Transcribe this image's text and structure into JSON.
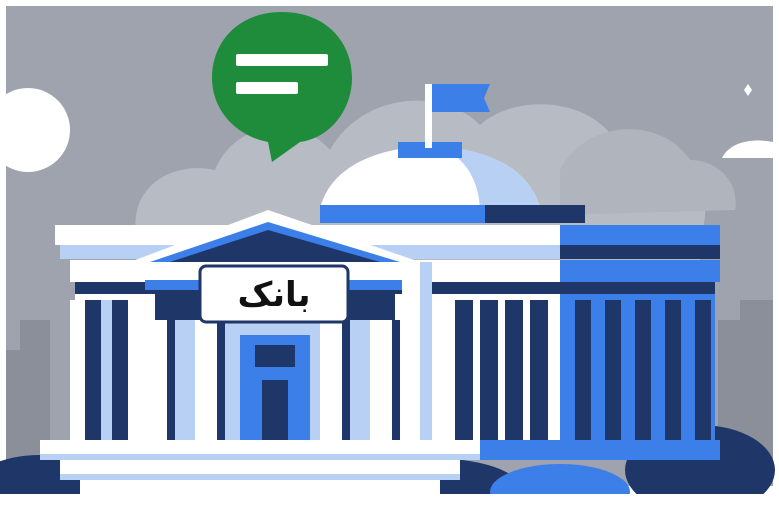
{
  "illustration": {
    "sign_text": "بانک",
    "subject": "bank-building",
    "icons": [
      "chat-bubble-icon",
      "flag-icon",
      "sun-icon",
      "sparkle-icon"
    ]
  },
  "colors": {
    "background": "#9ea3ad",
    "cloud": "#c6c9d0",
    "skyline": "#8a8f99",
    "navy": "#1e3668",
    "blue": "#3d7fe8",
    "light_blue": "#b9d0f5",
    "white": "#ffffff",
    "chat_green": "#1f8c3c"
  }
}
